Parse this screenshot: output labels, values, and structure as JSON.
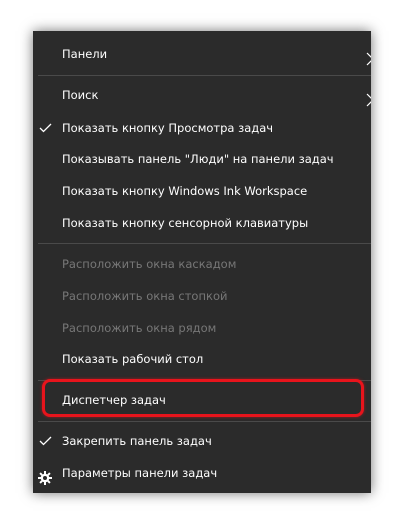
{
  "menu": {
    "items": [
      {
        "label": "Панели",
        "submenu": true
      },
      {
        "label": "Поиск",
        "submenu": true
      },
      {
        "label": "Показать кнопку Просмотра задач",
        "checked": true
      },
      {
        "label": "Показывать панель \"Люди\" на панели задач"
      },
      {
        "label": "Показать кнопку Windows Ink Workspace"
      },
      {
        "label": "Показать кнопку сенсорной клавиатуры"
      },
      {
        "label": "Расположить окна каскадом",
        "disabled": true
      },
      {
        "label": "Расположить окна стопкой",
        "disabled": true
      },
      {
        "label": "Расположить окна рядом",
        "disabled": true
      },
      {
        "label": "Показать рабочий стол"
      },
      {
        "label": "Диспетчер задач",
        "highlighted": true
      },
      {
        "label": "Закрепить панель задач",
        "checked": true
      },
      {
        "label": "Параметры панели задач",
        "icon": "gear-icon"
      }
    ]
  },
  "colors": {
    "menu_background": "#2b2b2b",
    "text": "#ffffff",
    "disabled_text": "#777777",
    "separator": "#4a4a4a",
    "highlight_border": "#e8141c"
  }
}
